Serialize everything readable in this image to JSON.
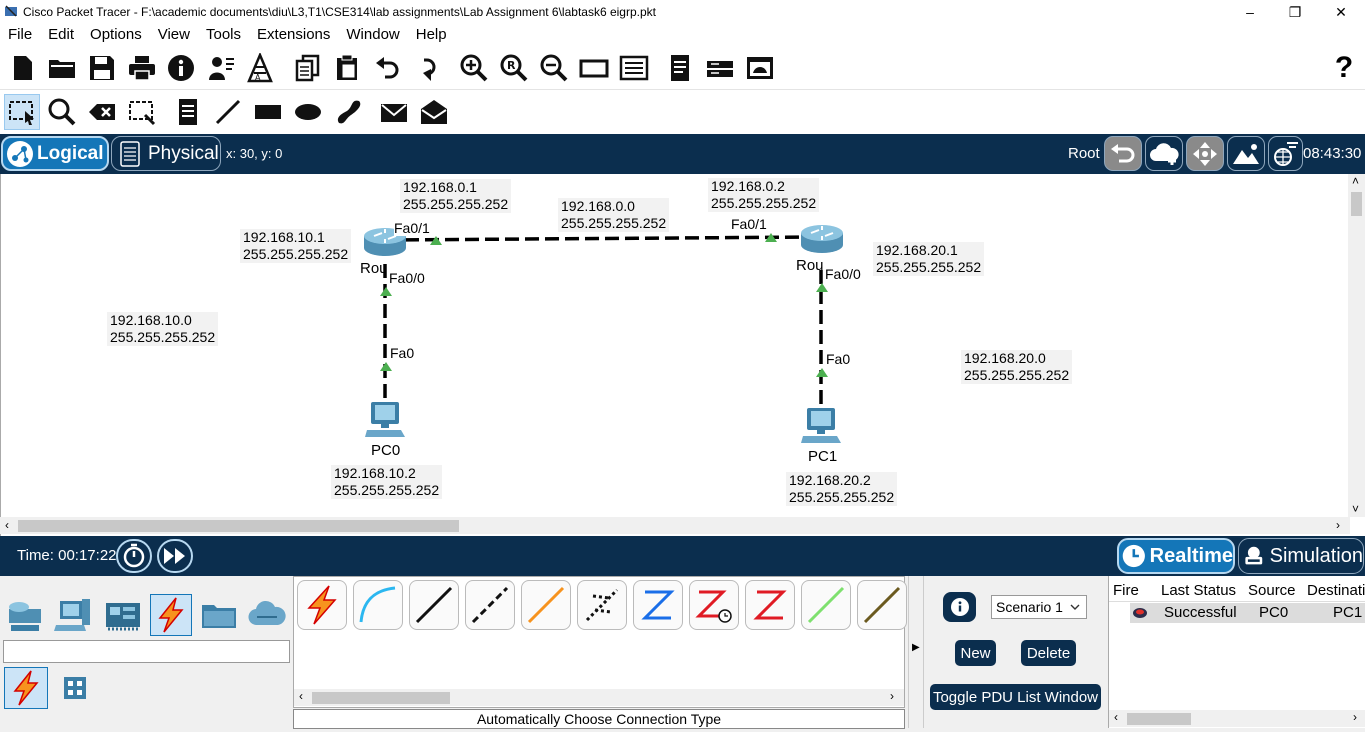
{
  "window": {
    "title": "Cisco Packet Tracer - F:\\academic documents\\diu\\L3,T1\\CSE314\\lab assignments\\Lab Assignment 6\\labtask6 eigrp.pkt",
    "minimize": "–",
    "restore": "❐",
    "close": "✕"
  },
  "menu": [
    "File",
    "Edit",
    "Options",
    "View",
    "Tools",
    "Extensions",
    "Window",
    "Help"
  ],
  "help_icon": "?",
  "logical_bar": {
    "logical_label": "Logical",
    "physical_label": "Physical",
    "coords": "x: 30, y: 0",
    "root_label": "Root",
    "clock": "08:43:30"
  },
  "topology": {
    "labels": {
      "r0_fa01_ip": "192.168.0.1",
      "r0_fa01_mask": "255.255.255.252",
      "net_0": "192.168.0.0",
      "net_0_mask": "255.255.255.252",
      "r1_fa01_ip": "192.168.0.2",
      "r1_fa01_mask": "255.255.255.252",
      "r0_fa00_ip": "192.168.10.1",
      "r0_fa00_mask": "255.255.255.252",
      "r1_fa00_ip": "192.168.20.1",
      "r1_fa00_mask": "255.255.255.252",
      "net_10": "192.168.10.0",
      "net_10_mask": "255.255.255.252",
      "net_20": "192.168.20.0",
      "net_20_mask": "255.255.255.252",
      "pc0_ip": "192.168.10.2",
      "pc0_mask": "255.255.255.252",
      "pc1_ip": "192.168.20.2",
      "pc1_mask": "255.255.255.252"
    },
    "ports": {
      "r0_fa01": "Fa0/1",
      "r1_fa01": "Fa0/1",
      "r0_fa00": "Fa0/0",
      "r1_fa00": "Fa0/0",
      "pc0_fa0": "Fa0",
      "pc1_fa0": "Fa0"
    },
    "devices": {
      "router0": "Rou",
      "router1": "Rou",
      "pc0": "PC0",
      "pc1": "PC1"
    },
    "link_color": "#000000",
    "port_up_color": "#4caf50"
  },
  "timebar": {
    "time": "Time: 00:17:22",
    "realtime": "Realtime",
    "simulation": "Simulation"
  },
  "device_panel": {
    "status_text": "Automatically Choose Connection Type"
  },
  "scenario": {
    "selected": "Scenario 1",
    "options": [
      "Scenario 1"
    ],
    "new_label": "New",
    "delete_label": "Delete",
    "toggle_label": "Toggle PDU List Window"
  },
  "pdu_table": {
    "headers": [
      "Fire",
      "Last Status",
      "Source",
      "Destinati"
    ],
    "rows": [
      {
        "last_status": "Successful",
        "source": "PC0",
        "destination": "PC1"
      }
    ]
  },
  "colors": {
    "dark_navy": "#0b2e4e",
    "accent_blue": "#1476b8"
  }
}
